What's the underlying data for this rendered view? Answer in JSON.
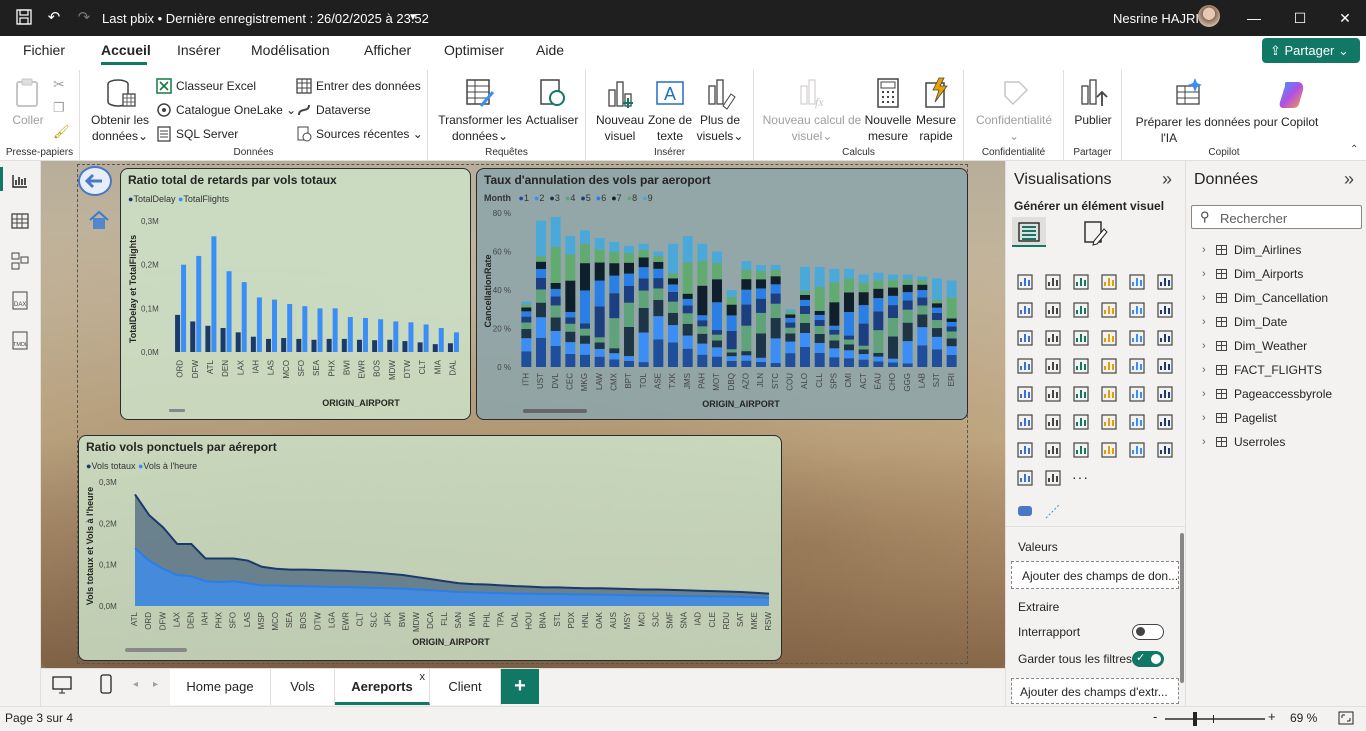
{
  "title_bar": {
    "doc_title": "Last pbix • Dernière enregistrement : 26/02/2025 à 23:52",
    "user": "Nesrine HAJRI"
  },
  "menu": {
    "items": [
      "Fichier",
      "Accueil",
      "Insérer",
      "Modélisation",
      "Afficher",
      "Optimiser",
      "Aide"
    ],
    "active": "Accueil",
    "share": "Partager"
  },
  "ribbon": {
    "clipboard": {
      "paste": "Coller",
      "label": "Presse-papiers"
    },
    "data": {
      "get_data_1": "Obtenir les",
      "get_data_2": "données",
      "excel": "Classeur Excel",
      "onelake": "Catalogue OneLake",
      "sql": "SQL Server",
      "enter": "Entrer des données",
      "dataverse": "Dataverse",
      "recent": "Sources récentes",
      "label": "Données"
    },
    "queries": {
      "transform_1": "Transformer les",
      "transform_2": "données",
      "refresh": "Actualiser",
      "label": "Requêtes"
    },
    "insert": {
      "new_visual_1": "Nouveau",
      "new_visual_2": "visuel",
      "textbox_1": "Zone de",
      "textbox_2": "texte",
      "more_1": "Plus de",
      "more_2": "visuels",
      "label": "Insérer"
    },
    "calc": {
      "new_calc_1": "Nouveau calcul de",
      "new_calc_2": "visuel",
      "new_measure_1": "Nouvelle",
      "new_measure_2": "mesure",
      "quick_1": "Mesure",
      "quick_2": "rapide",
      "label": "Calculs"
    },
    "confidentiality": {
      "btn": "Confidentialité",
      "label": "Confidentialité"
    },
    "share": {
      "publish": "Publier",
      "label": "Partager"
    },
    "copilot": {
      "prepare_1": "Préparer les données pour Copilot",
      "prepare_2": "l'IA",
      "label": "Copilot"
    }
  },
  "visuals": {
    "v1": {
      "title": "Ratio total de retards par vols totaux",
      "legend": [
        "TotalDelay",
        "TotalFlights"
      ],
      "ylabel": "TotalDelay et TotalFlights",
      "xlabel": "ORIGIN_AIRPORT"
    },
    "v2": {
      "title": "Taux d'annulation des vols par aeroport",
      "legend_title": "Month",
      "legend": [
        "1",
        "2",
        "3",
        "4",
        "5",
        "6",
        "7",
        "8",
        "9"
      ],
      "ylabel": "CancellationRate",
      "xlabel": "ORIGIN_AIRPORT"
    },
    "v3": {
      "title": "Ratio vols ponctuels par aéreport",
      "legend": [
        "Vols totaux",
        "Vols à l'heure"
      ],
      "ylabel": "Vols totaux et Vols à l'heure",
      "xlabel": "ORIGIN_AIRPORT"
    }
  },
  "chart_data": [
    {
      "type": "bar",
      "title": "Ratio total de retards par vols totaux",
      "xlabel": "ORIGIN_AIRPORT",
      "ylabel": "TotalDelay et TotalFlights",
      "yticks": [
        "0,0M",
        "0,1M",
        "0,2M",
        "0,3M"
      ],
      "ylim": [
        0,
        0.3
      ],
      "categories": [
        "ORD",
        "DFW",
        "ATL",
        "DEN",
        "LAX",
        "IAH",
        "LAS",
        "MCO",
        "SFO",
        "SEA",
        "PHX",
        "BWI",
        "EWR",
        "BOS",
        "MDW",
        "DTW",
        "CLT",
        "MIA",
        "DAL"
      ],
      "series": [
        {
          "name": "TotalDelay",
          "values": [
            0.085,
            0.07,
            0.06,
            0.055,
            0.045,
            0.035,
            0.03,
            0.032,
            0.03,
            0.028,
            0.03,
            0.03,
            0.028,
            0.027,
            0.028,
            0.025,
            0.022,
            0.018,
            0.02
          ]
        },
        {
          "name": "TotalFlights",
          "values": [
            0.2,
            0.22,
            0.265,
            0.185,
            0.16,
            0.125,
            0.12,
            0.11,
            0.105,
            0.1,
            0.1,
            0.08,
            0.078,
            0.075,
            0.07,
            0.068,
            0.063,
            0.055,
            0.045
          ]
        }
      ]
    },
    {
      "type": "bar",
      "stacked": true,
      "title": "Taux d'annulation des vols par aeroport",
      "xlabel": "ORIGIN_AIRPORT",
      "ylabel": "CancellationRate",
      "yticks": [
        "0 %",
        "20 %",
        "40 %",
        "60 %",
        "80 %"
      ],
      "ylim": [
        0,
        80
      ],
      "categories": [
        "ITH",
        "UST",
        "DVL",
        "CEC",
        "MKG",
        "LAW",
        "CMX",
        "BPT",
        "TOL",
        "ASE",
        "TXK",
        "JMS",
        "PAH",
        "MOT",
        "DBQ",
        "AZO",
        "JLN",
        "STC",
        "COU",
        "ALO",
        "CLL",
        "SPS",
        "CMI",
        "ACT",
        "EAU",
        "CHO",
        "GGG",
        "LAB",
        "SJT",
        "ERI"
      ],
      "values": [
        34,
        76,
        78,
        68,
        71,
        67,
        65,
        63,
        64,
        60,
        64,
        68,
        64,
        60,
        40,
        55,
        53,
        53,
        30,
        52,
        52,
        51,
        51,
        48,
        49,
        48,
        48,
        47,
        46,
        45
      ]
    },
    {
      "type": "area",
      "title": "Ratio vols ponctuels par aéreport",
      "xlabel": "ORIGIN_AIRPORT",
      "ylabel": "Vols totaux et Vols à l'heure",
      "yticks": [
        "0,0M",
        "0,1M",
        "0,2M",
        "0,3M"
      ],
      "ylim": [
        0,
        0.3
      ],
      "categories": [
        "ATL",
        "ORD",
        "DFW",
        "LAX",
        "DEN",
        "IAH",
        "PHX",
        "SFO",
        "LAS",
        "MSP",
        "MCO",
        "SEA",
        "BOS",
        "DTW",
        "LGA",
        "EWR",
        "CLT",
        "SLC",
        "JFK",
        "BWI",
        "MDW",
        "DCA",
        "FLL",
        "SAN",
        "MIA",
        "PHL",
        "TPA",
        "DAL",
        "HOU",
        "BNA",
        "STL",
        "PDX",
        "HNL",
        "OAK",
        "AUS",
        "MSY",
        "MCI",
        "SJC",
        "SMF",
        "SNA",
        "IAD",
        "CLE",
        "RDU",
        "SAT",
        "MKE",
        "RSW"
      ],
      "series": [
        {
          "name": "Vols totaux",
          "values": [
            0.27,
            0.22,
            0.19,
            0.15,
            0.15,
            0.115,
            0.115,
            0.115,
            0.11,
            0.095,
            0.09,
            0.088,
            0.088,
            0.087,
            0.086,
            0.085,
            0.083,
            0.081,
            0.078,
            0.075,
            0.07,
            0.065,
            0.06,
            0.055,
            0.053,
            0.052,
            0.05,
            0.048,
            0.047,
            0.045,
            0.045,
            0.044,
            0.043,
            0.043,
            0.042,
            0.041,
            0.04,
            0.04,
            0.039,
            0.038,
            0.037,
            0.036,
            0.035,
            0.034,
            0.032,
            0.03
          ]
        },
        {
          "name": "Vols à l'heure",
          "values": [
            0.14,
            0.11,
            0.09,
            0.075,
            0.072,
            0.06,
            0.058,
            0.06,
            0.055,
            0.05,
            0.05,
            0.048,
            0.048,
            0.047,
            0.046,
            0.046,
            0.045,
            0.044,
            0.043,
            0.042,
            0.04,
            0.038,
            0.036,
            0.034,
            0.033,
            0.032,
            0.031,
            0.03,
            0.03,
            0.029,
            0.029,
            0.028,
            0.028,
            0.027,
            0.027,
            0.026,
            0.026,
            0.025,
            0.025,
            0.024,
            0.024,
            0.023,
            0.023,
            0.022,
            0.021,
            0.02
          ]
        }
      ]
    }
  ],
  "viz_pane": {
    "title": "Visualisations",
    "generate": "Générer un élément visuel",
    "values_label": "Valeurs",
    "values_placeholder": "Ajouter des champs de don...",
    "extract_label": "Extraire",
    "interreport": "Interrapport",
    "keep_filters": "Garder tous les filtres",
    "extract_placeholder": "Ajouter des champs d'extr...",
    "more": "···"
  },
  "data_pane": {
    "title": "Données",
    "search_placeholder": "Rechercher",
    "tables": [
      "Dim_Airlines",
      "Dim_Airports",
      "Dim_Cancellation",
      "Dim_Date",
      "Dim_Weather",
      "FACT_FLIGHTS",
      "Pageaccessbyrole",
      "Pagelist",
      "Userroles"
    ]
  },
  "tabs": {
    "items": [
      "Home page",
      "Vols",
      "Aereports",
      "Client"
    ],
    "active": "Aereports",
    "close": "x",
    "add": "+"
  },
  "status": {
    "page": "Page 3 sur 4",
    "zoom": "69 %",
    "zoom_minus": "-",
    "zoom_plus": "+"
  },
  "colors": {
    "accent": "#117865",
    "dark_bar": "#1a3a6b",
    "blue_bar": "#3a8ef6",
    "month_colors": [
      "#1f4e9c",
      "#3a8ef6",
      "#1e3548",
      "#5fa37a",
      "#1b3f80",
      "#2a7fe6",
      "#0f1f2b",
      "#61aa70",
      "#4aa9d8"
    ]
  }
}
